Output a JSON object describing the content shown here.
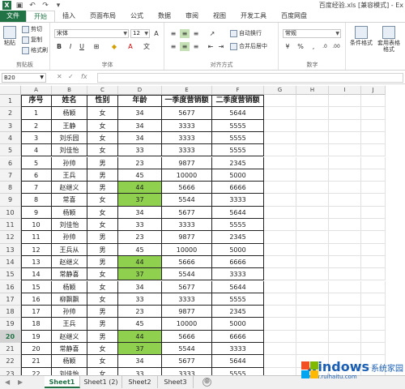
{
  "window": {
    "title": "百度经验.xls [兼容模式] - Ex"
  },
  "quick_access": [
    "save-icon",
    "undo-icon",
    "redo-icon",
    "customize-icon"
  ],
  "ribbon_tabs": [
    "文件",
    "开始",
    "插入",
    "页面布局",
    "公式",
    "数据",
    "审阅",
    "视图",
    "开发工具",
    "百度网盘"
  ],
  "ribbon": {
    "clipboard": {
      "paste": "粘贴",
      "cut": "剪切",
      "copy": "复制",
      "format_painter": "格式刷",
      "label": "剪贴板"
    },
    "font": {
      "name": "宋体",
      "size": "12",
      "bold": "B",
      "italic": "I",
      "underline": "U",
      "label": "字体"
    },
    "alignment": {
      "wrap": "自动换行",
      "merge": "合并后居中",
      "label": "对齐方式"
    },
    "number": {
      "format": "常规",
      "label": "数字"
    },
    "styles": {
      "conditional": "条件格式",
      "table": "套用表格格式"
    }
  },
  "formula_bar": {
    "name_box": "B20",
    "fx": "fx",
    "cancel": "✕",
    "enter": "✓",
    "value": ""
  },
  "columns": [
    "A",
    "B",
    "C",
    "D",
    "E",
    "F",
    "G",
    "H",
    "I",
    "J"
  ],
  "row_numbers": [
    "1",
    "2",
    "3",
    "4",
    "5",
    "6",
    "7",
    "8",
    "9",
    "10",
    "11",
    "12",
    "13",
    "14",
    "15",
    "16",
    "17",
    "18",
    "19",
    "20",
    "21",
    "22",
    "23"
  ],
  "selected_row": "20",
  "table": {
    "headers": [
      "序号",
      "姓名",
      "性别",
      "年龄",
      "一季度营销额",
      "二季度营销额"
    ],
    "rows": [
      [
        "1",
        "杨颖",
        "女",
        "34",
        "5677",
        "5644"
      ],
      [
        "2",
        "王静",
        "女",
        "34",
        "3333",
        "5555"
      ],
      [
        "3",
        "刘乐园",
        "女",
        "34",
        "3333",
        "5555"
      ],
      [
        "4",
        "刘佳怡",
        "女",
        "33",
        "3333",
        "5555"
      ],
      [
        "5",
        "孙帅",
        "男",
        "23",
        "9877",
        "2345"
      ],
      [
        "6",
        "王兵",
        "男",
        "45",
        "10000",
        "5000"
      ],
      [
        "7",
        "赵继义",
        "男",
        "44",
        "5666",
        "6666"
      ],
      [
        "8",
        "常喜",
        "女",
        "37",
        "5544",
        "3333"
      ],
      [
        "9",
        "杨颖",
        "女",
        "34",
        "5677",
        "5644"
      ],
      [
        "10",
        "刘佳怡",
        "女",
        "33",
        "3333",
        "5555"
      ],
      [
        "11",
        "孙帅",
        "男",
        "23",
        "9877",
        "2345"
      ],
      [
        "12",
        "王兵从",
        "男",
        "45",
        "10000",
        "5000"
      ],
      [
        "13",
        "赵继义",
        "男",
        "44",
        "5666",
        "6666"
      ],
      [
        "14",
        "常静喜",
        "女",
        "37",
        "5544",
        "3333"
      ],
      [
        "15",
        "杨颖",
        "女",
        "34",
        "5677",
        "5644"
      ],
      [
        "16",
        "柳飘飘",
        "女",
        "33",
        "3333",
        "5555"
      ],
      [
        "17",
        "孙帅",
        "男",
        "23",
        "9877",
        "2345"
      ],
      [
        "18",
        "王兵",
        "男",
        "45",
        "10000",
        "5000"
      ],
      [
        "19",
        "赵继义",
        "男",
        "44",
        "5666",
        "6666"
      ],
      [
        "20",
        "常静喜",
        "女",
        "37",
        "5544",
        "3333"
      ],
      [
        "21",
        "杨颖",
        "女",
        "34",
        "5677",
        "5644"
      ],
      [
        "22",
        "刘佳怡",
        "女",
        "33",
        "3333",
        "5555"
      ]
    ],
    "highlighted_rows": [
      6,
      7,
      12,
      13,
      18,
      19
    ],
    "highlight_color": "#8fd14f"
  },
  "sheet_tabs": [
    "Sheet1",
    "Sheet1 (2)",
    "Sheet2",
    "Sheet3"
  ],
  "active_sheet": "Sheet1",
  "add_sheet": "⊕",
  "watermark": {
    "main": "windows",
    "sub": "系统家园",
    "url": "www.ruihaitu.com"
  },
  "accent_color": "#217346"
}
